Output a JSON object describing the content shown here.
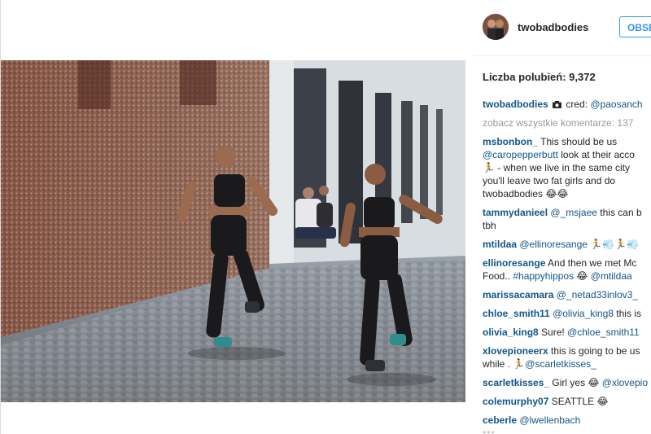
{
  "post": {
    "username": "twobadbodies",
    "follow_label": "OBSE",
    "likes_text": "Liczba polubień: 9,372",
    "view_all_comments": "zobacz wszystkie komentarze: 137"
  },
  "caption": {
    "user": "twobadbodies",
    "text_before": " cred: ",
    "mention": "@paosanch"
  },
  "comments": [
    {
      "user": "msbonbon_",
      "text": " This should be us"
    },
    {
      "mention": "@caropepperbutt",
      "text": " look at their acco"
    },
    {
      "text": "🏃 - when we live in the same city"
    },
    {
      "text": "you'll leave two fat girls and do"
    },
    {
      "text": "twobadbodies 😂😂"
    },
    {
      "user": "tammydanieel",
      "mention": "@_msjaee",
      "text": " this can b"
    },
    {
      "text": "tbh"
    },
    {
      "user": "mtildaa",
      "mention": "@ellinoresange",
      "text": " 🏃💨🏃💨"
    },
    {
      "user": "ellinoresange",
      "text": " And then we met Mc"
    },
    {
      "text": "Food.. ",
      "mention": "#happyhippos",
      "text2": " 😂 ",
      "mention2": "@mtildaa"
    },
    {
      "user": "marissacamara",
      "mention": "@_netad33inlov3_"
    },
    {
      "user": "chloe_smith11",
      "mention": "@olivia_king8",
      "text": " this is"
    },
    {
      "user": "olivia_king8",
      "text": " Sure! ",
      "mention": "@chloe_smith11"
    },
    {
      "user": "xlovepioneerx",
      "text": " this is going to be us"
    },
    {
      "text": "while . 🏃",
      "mention": "@scarletkisses_"
    },
    {
      "user": "scarletkisses_",
      "text": " Girl yes 😂 ",
      "mention": "@xlovepio"
    },
    {
      "user": "colemurphy07",
      "text": " SEATTLE 😂"
    },
    {
      "user": "ceberle",
      "mention": "@lwellenbach"
    }
  ],
  "more_dots": "•••",
  "icons": {
    "camera": "camera-icon"
  },
  "colors": {
    "link": "#125688",
    "follow_blue": "#3897f0",
    "muted": "#999999"
  }
}
